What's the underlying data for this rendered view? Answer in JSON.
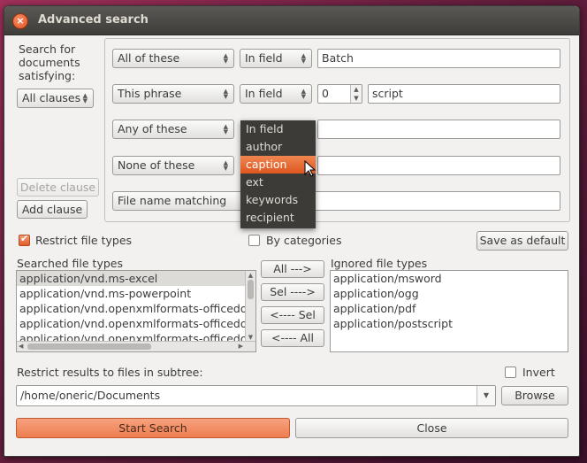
{
  "window": {
    "title": "Advanced search"
  },
  "search_for": {
    "label": "Search for documents satisfying:",
    "clauses_combo": "All clauses"
  },
  "clauses": [
    {
      "type": "All of these",
      "field": "In field",
      "value": "Batch"
    },
    {
      "type": "This phrase",
      "field": "In field",
      "spin": "0",
      "value": "script"
    },
    {
      "type": "Any of these",
      "value": ""
    },
    {
      "type": "None of these",
      "value": ""
    },
    {
      "type": "File name matching",
      "value": ""
    }
  ],
  "buttons": {
    "delete_clause": "Delete clause",
    "add_clause": "Add clause",
    "save_default": "Save as default",
    "all_right": "All --->",
    "sel_right": "Sel ---->",
    "sel_left": "<---- Sel",
    "all_left": "<---- All",
    "browse": "Browse",
    "start_search": "Start Search",
    "close": "Close"
  },
  "field_popup": [
    "In field",
    "author",
    "caption",
    "ext",
    "keywords",
    "recipient"
  ],
  "field_popup_highlight": "caption",
  "filetypes": {
    "restrict_label": "Restrict file types",
    "by_categories_label": "By categories",
    "searched_label": "Searched file types",
    "ignored_label": "Ignored file types",
    "searched": [
      "application/vnd.ms-excel",
      "application/vnd.ms-powerpoint",
      "application/vnd.openxmlformats-officedocument",
      "application/vnd.openxmlformats-officedocument",
      "application/vnd.openxmlformats-officedocument"
    ],
    "ignored": [
      "application/msword",
      "application/ogg",
      "application/pdf",
      "application/postscript"
    ]
  },
  "subtree": {
    "label": "Restrict results to files in subtree:",
    "invert_label": "Invert",
    "path": "/home/oneric/Documents"
  }
}
